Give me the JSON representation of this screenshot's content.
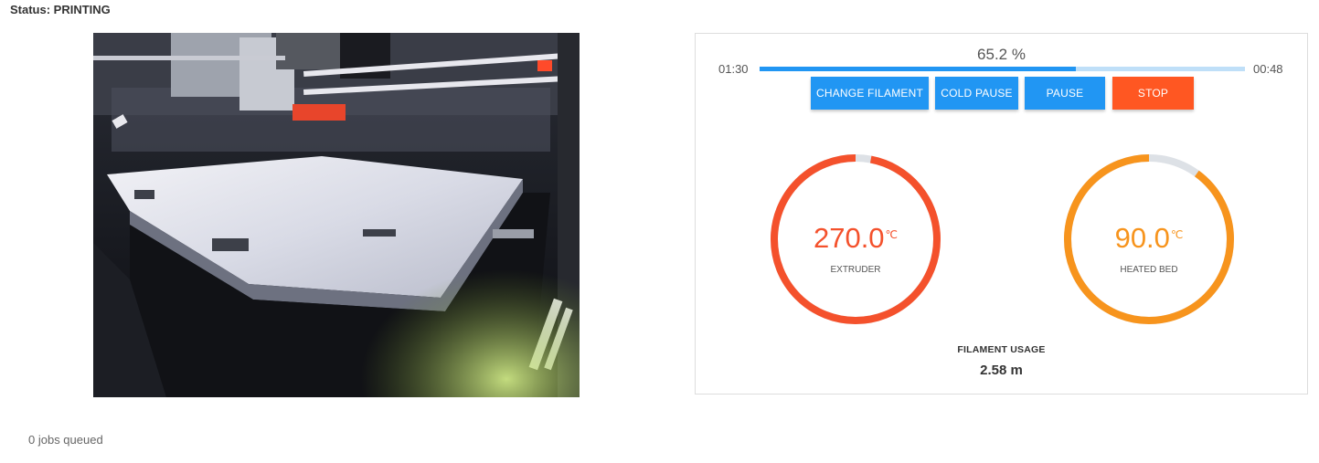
{
  "status": {
    "label": "Status: ",
    "value": "PRINTING"
  },
  "camera": {
    "alt": "Printer camera view"
  },
  "progress": {
    "percent_text": "65.2 %",
    "fraction": 0.652,
    "elapsed": "01:30",
    "remaining": "00:48"
  },
  "buttons": {
    "change_filament": "CHANGE FILAMENT",
    "cold_pause": "COLD PAUSE",
    "pause": "PAUSE",
    "stop": "STOP"
  },
  "extruder": {
    "temp": "270.0",
    "unit": "℃",
    "label": "EXTRUDER",
    "fraction": 0.97,
    "color": "#f4512c"
  },
  "bed": {
    "temp": "90.0",
    "unit": "℃",
    "label": "HEATED BED",
    "fraction": 0.9,
    "color": "#f7941d"
  },
  "filament": {
    "title": "FILAMENT USAGE",
    "value": "2.58 m"
  },
  "queue": {
    "text": "0 jobs queued"
  },
  "colors": {
    "primary": "#2196f3",
    "primary_light": "#bfdff8",
    "danger": "#ff5722",
    "gauge_track": "#dde1e6"
  }
}
